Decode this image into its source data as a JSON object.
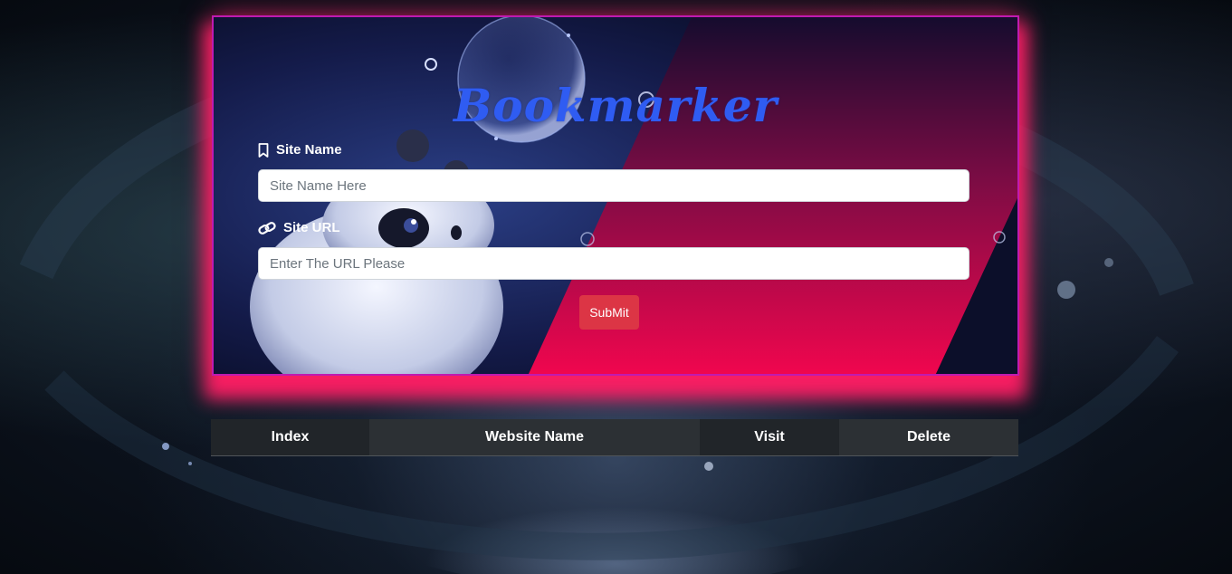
{
  "app": {
    "title": "Bookmarker"
  },
  "form": {
    "site_name": {
      "label": "Site Name",
      "placeholder": "Site Name Here",
      "value": "",
      "icon": "bookmark-icon"
    },
    "site_url": {
      "label": "Site URL",
      "placeholder": "Enter The URL Please",
      "value": "",
      "icon": "link-icon"
    },
    "submit_label": "SubMit"
  },
  "table": {
    "headers": [
      "Index",
      "Website Name",
      "Visit",
      "Delete"
    ],
    "rows": []
  },
  "colors": {
    "title": "#2f5cf2",
    "card_border": "#c01ab0",
    "glow": "#ff1e64",
    "submit": "#dc3545",
    "table_header_dark": "#212529",
    "table_header_light": "#2c3034"
  }
}
